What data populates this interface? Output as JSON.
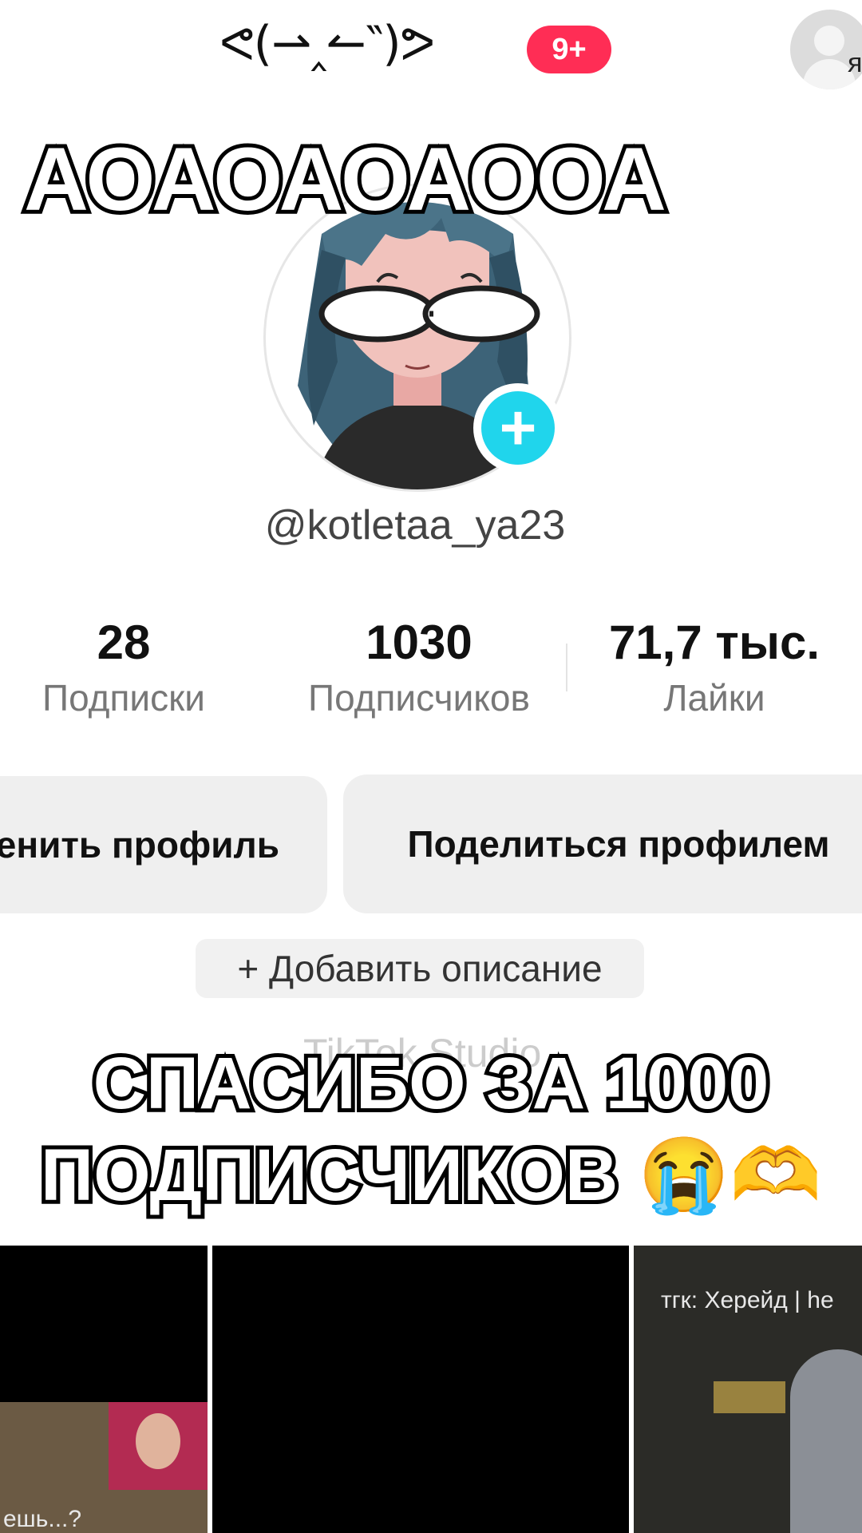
{
  "header": {
    "title": "ᕙ(⇀‸↼‶)ᕗ",
    "badge": "9+",
    "avatar_letter": "я"
  },
  "captions": {
    "top": "АОАОАОАООА",
    "bottom_line1": "СПАСИБО ЗА 1000",
    "bottom_line2": "ПОДПИСЧИКОВ 😭🫶"
  },
  "profile": {
    "username": "@kotletaa_ya23",
    "add_icon": "plus-icon"
  },
  "stats": [
    {
      "value": "28",
      "label": "Подписки"
    },
    {
      "value": "1030",
      "label": "Подписчиков"
    },
    {
      "value": "71,7 тыс.",
      "label": "Лайки"
    }
  ],
  "actions": {
    "edit_profile": "енить профиль",
    "share_profile": "Поделиться профилем",
    "add_description": "+ Добавить описание"
  },
  "behind_caption": "TikTok Studio",
  "grid": [
    {
      "overlay_text": "ешь...?"
    },
    {
      "overlay_text": ""
    },
    {
      "overlay_text": "тгк: Херейд | he"
    }
  ],
  "colors": {
    "accent": "#20d5ec",
    "badge": "#ff2d55"
  }
}
